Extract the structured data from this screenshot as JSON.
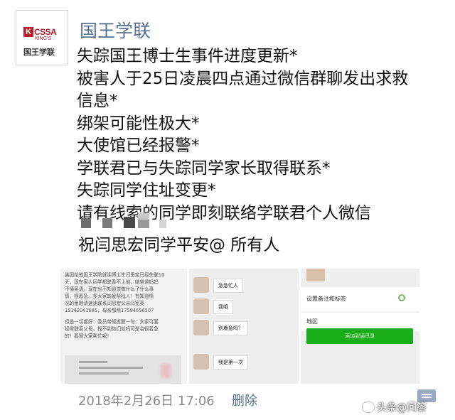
{
  "account": {
    "name": "国王学联",
    "avatar_logo_text": "CSSA",
    "avatar_logo_letter": "K",
    "avatar_logo_subtext": "KING'S",
    "avatar_logo_cn": "国王学联"
  },
  "post": {
    "lines": [
      "失踪国王博士生事件进度更新*",
      "被害人于25日凌晨四点通过微信群聊发出求救",
      "信息*",
      "绑架可能性极大*",
      "大使馆已经报警*",
      "学联君已与失踪同学家长取得联系*",
      "失踪同学住址变更*",
      "请有线索的同学即刻联络学联君个人微信"
    ],
    "mention_line": "祝闫思宏同学平安@ 所有人"
  },
  "images": {
    "img1_text": [
      "美国伦敦国王学院就读博士生闫思宏已经失联10",
      "天，现在家人同学都联系不上他，她爸爸妈妈",
      "不懂英语，现在也不知道该做什么了什么事",
      "情，很着急。多大家转发帮找人！有知道情",
      "况的童鞋请速速联系闫思宏父亲闫宪英",
      "15142041685，母亲邹燕17584656507",
      "",
      "但是一切都好：委员带领提醒一句：大家可要",
      "经常联系父母，找不到你们就吗可是会很着急",
      "的！着慧大家帮忙呢！"
    ],
    "img2_messages": [
      "急急忙人",
      "我哦",
      "别着急吗？",
      "我是第一次"
    ],
    "img3_row1": "设置备注和标签",
    "img3_row2": "地区",
    "img3_button": "添加到通讯录"
  },
  "footer": {
    "timestamp": "2018年2月26日 17:06",
    "delete_label": "删除",
    "watermark": "头条@问答"
  },
  "colors": {
    "link_blue": "#59718e",
    "timestamp_gray": "#8a8a8a",
    "wechat_green": "#1aad19"
  },
  "icons": {
    "comment": "comment-icon",
    "watermark": "toutiao-logo-icon"
  }
}
